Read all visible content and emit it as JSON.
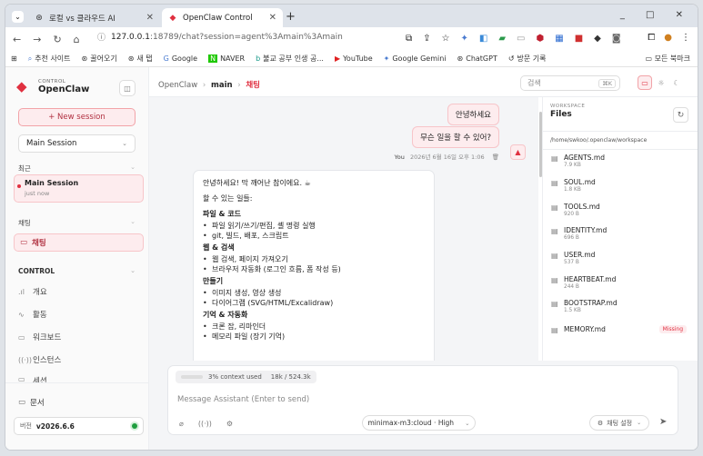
{
  "browser": {
    "tabs": [
      {
        "title": "로컬 vs 클라우드 AI"
      },
      {
        "title": "OpenClaw Control"
      }
    ],
    "url_host": "127.0.0.1",
    "url_path": ":18789/chat?session=agent%3Amain%3Amain",
    "bookmarks": [
      "추천 사이트",
      "꿀어오기",
      "새 탭",
      "Google",
      "NAVER",
      "불교 공부 인생 공...",
      "YouTube",
      "Google Gemini",
      "ChatGPT",
      "방문 기록"
    ],
    "all_bookmarks": "모든 북마크"
  },
  "sidebar": {
    "brand_small": "CONTROL",
    "brand_big": "OpenClaw",
    "new_session": "+ New session",
    "session_select": "Main Session",
    "recent_header": "최근",
    "recent_item_title": "Main Session",
    "recent_item_sub": "just now",
    "chat_header": "채팅",
    "chat_item": "채팅",
    "control_header": "CONTROL",
    "nav": [
      "개요",
      "활동",
      "워크보드",
      "인스턴스",
      "세션"
    ],
    "docs": "문서",
    "version_label": "버전",
    "version_value": "v2026.6.6"
  },
  "header": {
    "crumb_root": "OpenClaw",
    "crumb_mid": "main",
    "crumb_cur": "채팅",
    "search_placeholder": "검색",
    "search_kbd": "⌘K"
  },
  "chat": {
    "user_msg_1": "안녕하세요",
    "user_msg_2": "무슨 일을 할 수 있어?",
    "user_name": "You",
    "user_time": "2026년 6월 16일 오후 1:06",
    "assistant": {
      "greeting": "안녕하세요! 막 깨어난 참이에요. ☕",
      "intro": "할 수 있는 일들:",
      "sections": [
        {
          "title": "파일 & 코드",
          "items": [
            "파일 읽기/쓰기/편집, 셸 명령 실행",
            "git, 빌드, 배포, 스크립트"
          ]
        },
        {
          "title": "웹 & 검색",
          "items": [
            "웹 검색, 페이지 가져오기",
            "브라우저 자동화 (로그인 흐름, 폼 작성 등)"
          ]
        },
        {
          "title": "만들기",
          "items": [
            "이미지 생성, 영상 생성",
            "다이어그램 (SVG/HTML/Excalidraw)"
          ]
        },
        {
          "title": "기억 & 자동화",
          "items": [
            "크론 잡, 리마인더",
            "메모리 파일 (장기 기억)"
          ]
        }
      ]
    }
  },
  "files": {
    "small": "WORKSPACE",
    "title": "Files",
    "path": "/home/swkoo/.openclaw/workspace",
    "items": [
      {
        "name": "AGENTS.md",
        "size": "7.9 KB"
      },
      {
        "name": "SOUL.md",
        "size": "1.8 KB"
      },
      {
        "name": "TOOLS.md",
        "size": "920 B"
      },
      {
        "name": "IDENTITY.md",
        "size": "696 B"
      },
      {
        "name": "USER.md",
        "size": "537 B"
      },
      {
        "name": "HEARTBEAT.md",
        "size": "244 B"
      },
      {
        "name": "BOOTSTRAP.md",
        "size": "1.5 KB"
      },
      {
        "name": "MEMORY.md",
        "size": ""
      }
    ],
    "missing_label": "Missing"
  },
  "composer": {
    "context_pct": "3% context used",
    "context_tokens": "18k / 524.3k",
    "placeholder": "Message Assistant (Enter to send)",
    "model": "minimax-m3:cloud · High",
    "chat_settings": "채팅 설정"
  },
  "colors": {
    "accent": "#e03040",
    "accent_bg": "#fdecee",
    "status_ok": "#1e9e3e"
  }
}
